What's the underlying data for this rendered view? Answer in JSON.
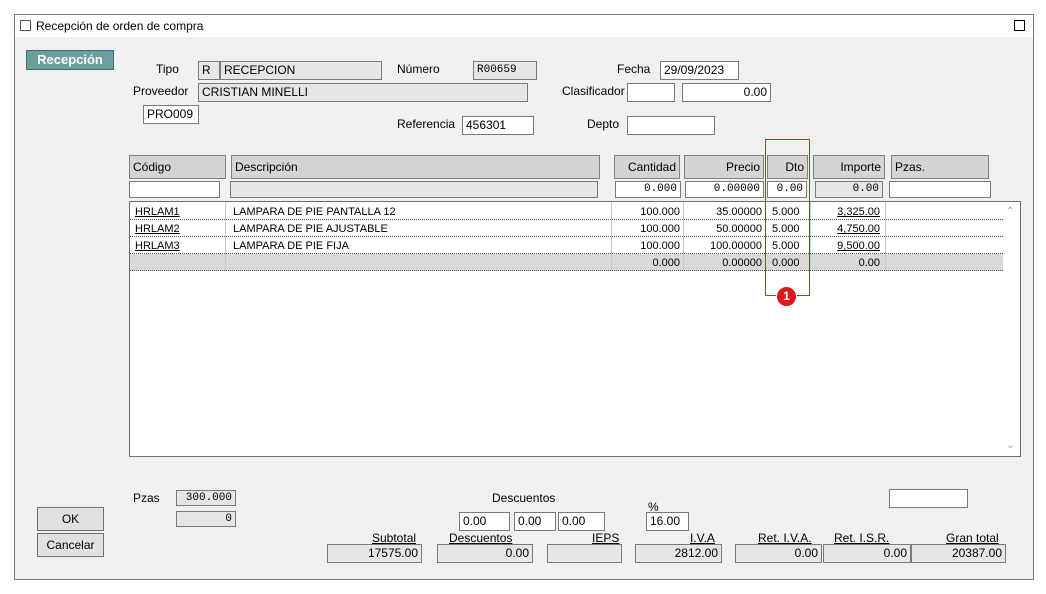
{
  "window": {
    "title": "Recepción de orden de compra"
  },
  "side": {
    "recepcion_label": "Recepción"
  },
  "header": {
    "tipo_label": "Tipo",
    "tipo_code": "R",
    "tipo_value": "RECEPCION",
    "numero_label": "Número",
    "numero_value": "R00659",
    "fecha_label": "Fecha",
    "fecha_value": "29/09/2023",
    "proveedor_label": "Proveedor",
    "proveedor_name": "CRISTIAN MINELLI",
    "proveedor_code": "PRO009",
    "clasificador_label": "Clasificador",
    "clasificador_value": "",
    "clasificador_amount": "0.00",
    "referencia_label": "Referencia",
    "referencia_value": "456301",
    "depto_label": "Depto",
    "depto_value": ""
  },
  "columns": {
    "codigo": "Código",
    "descripcion": "Descripción",
    "cantidad": "Cantidad",
    "precio": "Precio",
    "dto": "Dto",
    "importe": "Importe",
    "pzas": "Pzas."
  },
  "entry": {
    "codigo": "",
    "descripcion": "",
    "cantidad": "0.000",
    "precio": "0.00000",
    "dto": "0.00",
    "importe": "0.00",
    "pzas": ""
  },
  "rows": [
    {
      "codigo": "HRLAM1",
      "descripcion": "LAMPARA DE PIE PANTALLA 12",
      "cantidad": "100.000",
      "precio": "35.00000",
      "dto": "5.000",
      "importe": "3,325.00"
    },
    {
      "codigo": "HRLAM2",
      "descripcion": "LAMPARA DE PIE AJUSTABLE",
      "cantidad": "100.000",
      "precio": "50.00000",
      "dto": "5.000",
      "importe": "4,750.00"
    },
    {
      "codigo": "HRLAM3",
      "descripcion": "LAMPARA DE PIE FIJA",
      "cantidad": "100.000",
      "precio": "100.00000",
      "dto": "5.000",
      "importe": "9,500.00"
    },
    {
      "codigo": "",
      "descripcion": "",
      "cantidad": "0.000",
      "precio": "0.00000",
      "dto": "0.000",
      "importe": "0.00"
    }
  ],
  "annotation": {
    "marker": "1"
  },
  "footer": {
    "pzas_label": "Pzas",
    "pzas_value": "300.000",
    "pzas_value2": "0",
    "descuentos_label": "Descuentos",
    "desc1": "0.00",
    "desc2": "0.00",
    "desc3": "0.00",
    "pct_label": "%",
    "pct_value": "16.00",
    "right_field": "",
    "subtotal_label": "Subtotal",
    "subtotal_value": "17575.00",
    "descuentos_total_label": "Descuentos",
    "descuentos_total_value": "0.00",
    "ieps_label": "IEPS",
    "ieps_value": "",
    "iva_label": "I.V.A",
    "iva_value": "2812.00",
    "ret_iva_label": "Ret. I.V.A.",
    "ret_iva_value": "0.00",
    "ret_isr_label": "Ret. I.S.R.",
    "ret_isr_value": "0.00",
    "gran_total_label": "Gran total",
    "gran_total_value": "20387.00"
  },
  "buttons": {
    "ok": "OK",
    "cancel": "Cancelar"
  },
  "colors": {
    "accent": "#6b9e9e",
    "annotation": "#e02020",
    "window_bg": "#f0f0f0"
  }
}
